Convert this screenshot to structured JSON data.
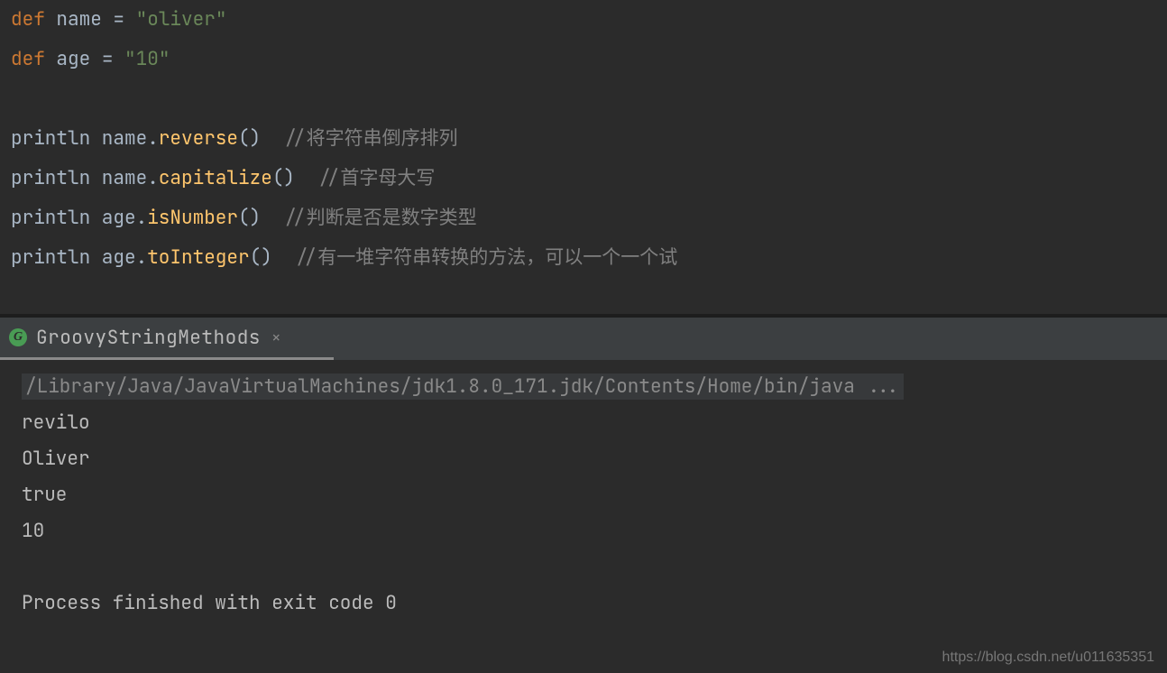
{
  "code": {
    "lines": [
      {
        "tokens": [
          {
            "cls": "kw",
            "t": "def"
          },
          {
            "cls": "ident",
            "t": " name "
          },
          {
            "cls": "op",
            "t": "= "
          },
          {
            "cls": "str",
            "t": "\"oliver\""
          }
        ]
      },
      {
        "tokens": [
          {
            "cls": "kw",
            "t": "def"
          },
          {
            "cls": "ident",
            "t": " age "
          },
          {
            "cls": "op",
            "t": "= "
          },
          {
            "cls": "str",
            "t": "\"10\""
          }
        ]
      },
      {
        "tokens": []
      },
      {
        "tokens": [
          {
            "cls": "ident",
            "t": "println name."
          },
          {
            "cls": "method",
            "t": "reverse"
          },
          {
            "cls": "ident",
            "t": "()  "
          },
          {
            "cls": "comment",
            "t": "//将字符串倒序排列"
          }
        ]
      },
      {
        "tokens": [
          {
            "cls": "ident",
            "t": "println name."
          },
          {
            "cls": "method",
            "t": "capitalize"
          },
          {
            "cls": "ident",
            "t": "()  "
          },
          {
            "cls": "comment",
            "t": "//首字母大写"
          }
        ]
      },
      {
        "tokens": [
          {
            "cls": "ident",
            "t": "println age."
          },
          {
            "cls": "method",
            "t": "isNumber"
          },
          {
            "cls": "ident",
            "t": "()  "
          },
          {
            "cls": "comment",
            "t": "//判断是否是数字类型"
          }
        ]
      },
      {
        "tokens": [
          {
            "cls": "ident",
            "t": "println age."
          },
          {
            "cls": "method",
            "t": "toInteger"
          },
          {
            "cls": "ident",
            "t": "()  "
          },
          {
            "cls": "comment",
            "t": "//有一堆字符串转换的方法，可以一个一个试"
          }
        ]
      }
    ]
  },
  "tab": {
    "icon_letter": "G",
    "label": "GroovyStringMethods",
    "close": "×"
  },
  "console": {
    "command": "/Library/Java/JavaVirtualMachines/jdk1.8.0_171.jdk/Contents/Home/bin/java ...",
    "output": [
      "revilo",
      "Oliver",
      "true",
      "10",
      "",
      "Process finished with exit code 0"
    ]
  },
  "watermark": "https://blog.csdn.net/u011635351"
}
